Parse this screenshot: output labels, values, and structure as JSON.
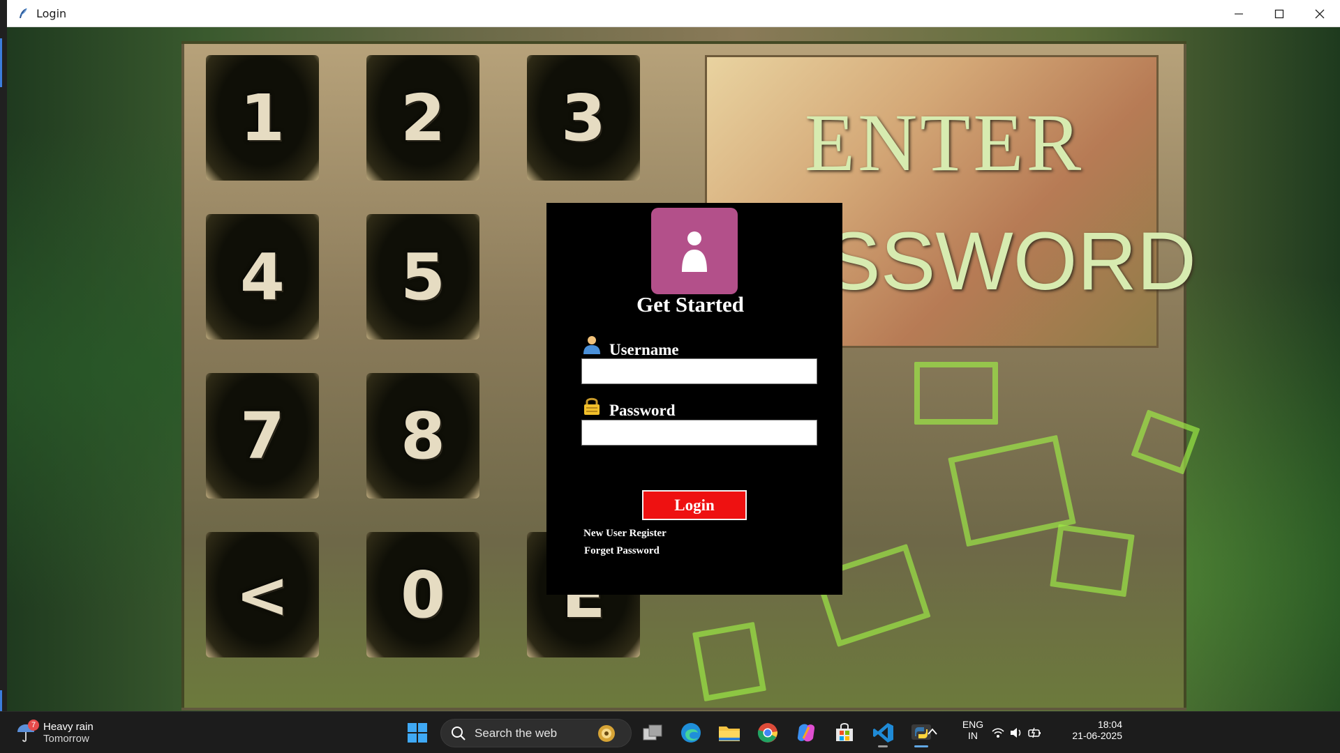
{
  "window": {
    "title": "Login"
  },
  "background": {
    "keypad_keys": [
      "1",
      "2",
      "3",
      "4",
      "5",
      "7",
      "8",
      "<",
      "0",
      "E"
    ],
    "sign_line1": "ENTER",
    "sign_line2": "SSWORD"
  },
  "login": {
    "heading": "Get Started",
    "username_label": "Username",
    "username_value": "",
    "password_label": "Password",
    "password_value": "",
    "login_button": "Login",
    "register_link": "New User Register",
    "forget_link": "Forget Password",
    "avatar_color": "#b3508a",
    "button_color": "#ee1111"
  },
  "taskbar": {
    "weather_title": "Heavy rain",
    "weather_sub": "Tomorrow",
    "weather_badge": "7",
    "search_placeholder": "Search the web",
    "apps": [
      "start-icon",
      "task-view-icon",
      "edge-icon",
      "file-explorer-icon",
      "chrome-icon",
      "copilot-icon",
      "store-icon",
      "vscode-icon",
      "python-icon"
    ],
    "lang_line1": "ENG",
    "lang_line2": "IN",
    "time": "18:04",
    "date": "21-06-2025"
  }
}
